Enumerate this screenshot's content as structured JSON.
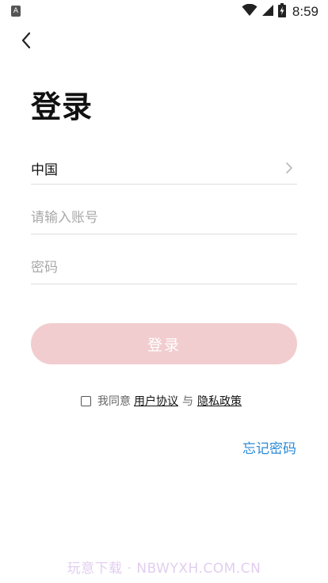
{
  "status_bar": {
    "app_icon_letter": "A",
    "time": "8:59",
    "icons": [
      "wifi-icon",
      "cell-signal-icon",
      "battery-charging-icon"
    ]
  },
  "header": {
    "back_icon": "chevron-left-icon"
  },
  "page": {
    "title": "登录"
  },
  "form": {
    "country_value": "中国",
    "account_placeholder": "请输入账号",
    "password_placeholder": "密码",
    "login_button_label": "登录"
  },
  "agreement": {
    "prefix": "我同意",
    "user_agreement_link": "用户协议",
    "conjunction": "与",
    "privacy_policy_link": "隐私政策",
    "checked": false
  },
  "links": {
    "forgot_password": "忘记密码"
  },
  "watermark": {
    "text": "玩意下载 · NBWYXH.COM.CN"
  },
  "colors": {
    "login_button_bg": "#f1cdcf",
    "link_blue": "#2b8ad6",
    "divider": "#dcdcdc"
  }
}
